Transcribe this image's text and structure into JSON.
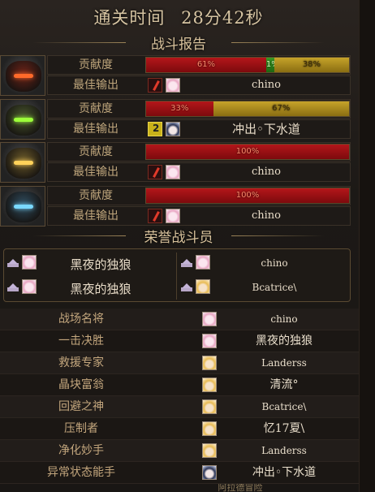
{
  "header": {
    "title_label": "通关时间",
    "title_value": "28分42秒"
  },
  "battle_report": {
    "section_title": "战斗报告",
    "contribution_label": "贡献度",
    "best_output_label": "最佳输出",
    "players": [
      {
        "portrait": "dark-knight-red-icon",
        "segments": [
          {
            "pct": 61,
            "label": "61%",
            "color": "red"
          },
          {
            "pct": 1,
            "label": "1%",
            "color": "green"
          },
          {
            "pct": 38,
            "label": "38%",
            "color": "gold"
          }
        ],
        "best_weapon": "red-blade-icon",
        "best_avatar": "pink",
        "best_name": "chino"
      },
      {
        "portrait": "green-mech-icon",
        "segments": [
          {
            "pct": 33,
            "label": "33%",
            "color": "red"
          },
          {
            "pct": 67,
            "label": "67%",
            "color": "gold"
          }
        ],
        "best_weapon": "gold-skill-icon",
        "best_avatar": "dark",
        "best_name": "冲出◦下水道"
      },
      {
        "portrait": "gold-knight-icon",
        "segments": [
          {
            "pct": 100,
            "label": "100%",
            "color": "red"
          }
        ],
        "best_weapon": "red-blade-icon",
        "best_avatar": "pink",
        "best_name": "chino"
      },
      {
        "portrait": "blue-knight-icon",
        "segments": [
          {
            "pct": 100,
            "label": "100%",
            "color": "red"
          }
        ],
        "best_weapon": "red-blade-icon",
        "best_avatar": "pink",
        "best_name": "chino"
      }
    ]
  },
  "honor": {
    "section_title": "荣誉战斗员",
    "entries": [
      {
        "name": "黑夜的独狼",
        "avatar": "pink"
      },
      {
        "name": "chino",
        "avatar": "pink"
      },
      {
        "name": "黑夜的独狼",
        "avatar": "pink"
      },
      {
        "name": "Bcatrice\\",
        "avatar": "blonde"
      }
    ]
  },
  "awards": [
    {
      "title": "战场名将",
      "name": "chino",
      "avatar": "pink"
    },
    {
      "title": "一击决胜",
      "name": "黑夜的独狼",
      "avatar": "pink"
    },
    {
      "title": "救援专家",
      "name": "Landerss",
      "avatar": "blonde"
    },
    {
      "title": "晶块富翁",
      "name": "清流°",
      "avatar": "blonde"
    },
    {
      "title": "回避之神",
      "name": "Bcatrice\\",
      "avatar": "blonde"
    },
    {
      "title": "压制者",
      "name": "忆17夏\\",
      "avatar": "blonde"
    },
    {
      "title": "净化妙手",
      "name": "Landerss",
      "avatar": "blonde"
    },
    {
      "title": "异常状态能手",
      "name": "冲出◦下水道",
      "avatar": "dark"
    }
  ],
  "footer_text": "阿拉德冒险",
  "colors": {
    "red": "#b4161a",
    "green": "#3a9a24",
    "gold": "#c6a32a"
  }
}
